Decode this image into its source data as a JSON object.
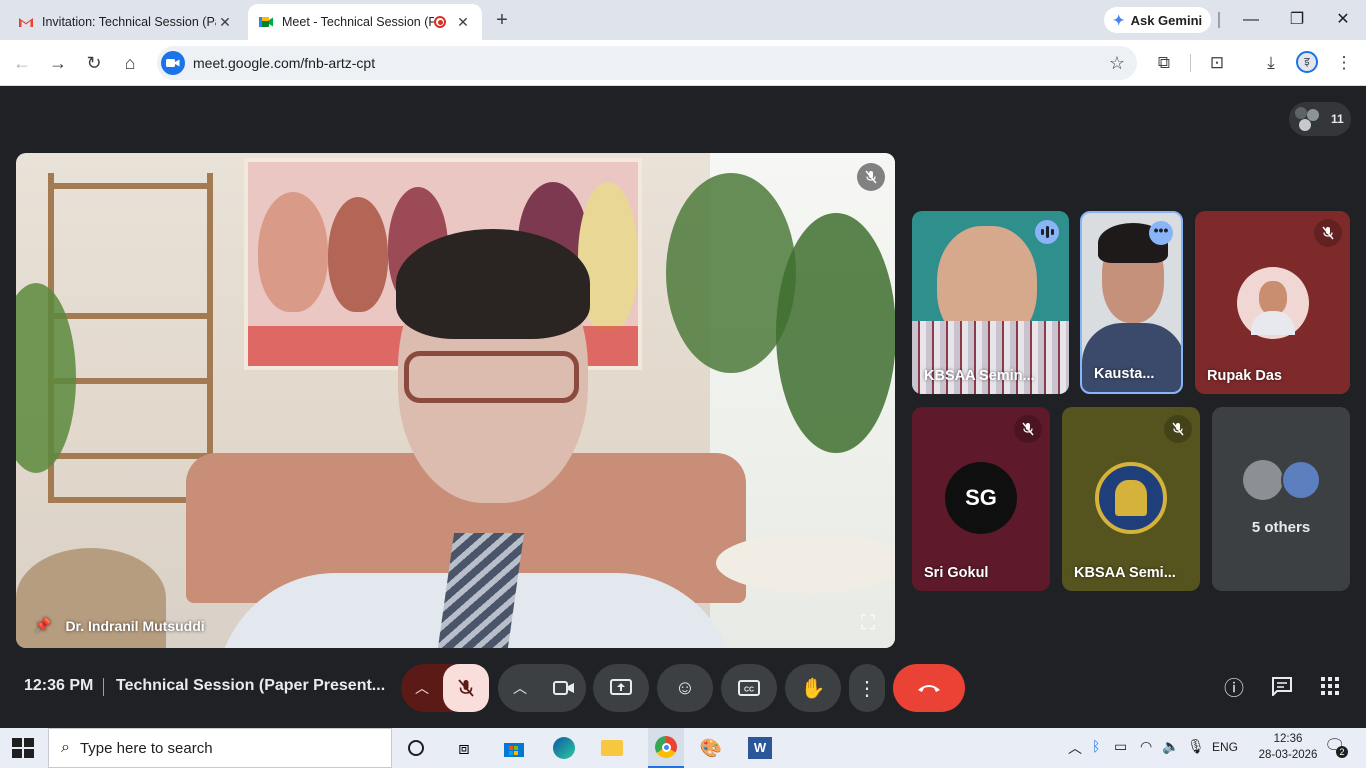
{
  "browser": {
    "tabs": [
      {
        "title": "Invitation: Technical Session (Pa",
        "active": false
      },
      {
        "title": "Meet - Technical Session (Pa",
        "active": true
      }
    ],
    "ask_gemini": "Ask Gemini",
    "url": "meet.google.com/fnb-artz-cpt",
    "window_buttons": {
      "minimize": "—",
      "restore": "❐",
      "close": "✕"
    }
  },
  "meet": {
    "participant_count": "11",
    "main_speaker": {
      "name": "Dr. Indranil Mutsuddi",
      "muted": true
    },
    "tiles": [
      {
        "name": "KBSAA Semin...",
        "indicator": "speaking"
      },
      {
        "name": "Kausta...",
        "indicator": "more"
      },
      {
        "name": "Rupak Das",
        "indicator": "muted"
      },
      {
        "name": "Sri Gokul",
        "indicator": "muted"
      },
      {
        "name": "KBSAA Semi...",
        "indicator": "muted"
      },
      {
        "name": "5 others",
        "indicator": "none"
      }
    ],
    "bottom": {
      "time": "12:36 PM",
      "title": "Technical Session (Paper Present..."
    },
    "colors": {
      "end_call": "#ea4335",
      "mic_off_bg": "#f9dedc",
      "mic_off_caret": "#5c1a16",
      "speaking": "#8ab4f8"
    }
  },
  "taskbar": {
    "search_placeholder": "Type here to search",
    "language": "ENG",
    "time": "12:36",
    "date": "28-03-2026",
    "notifications": "2"
  }
}
